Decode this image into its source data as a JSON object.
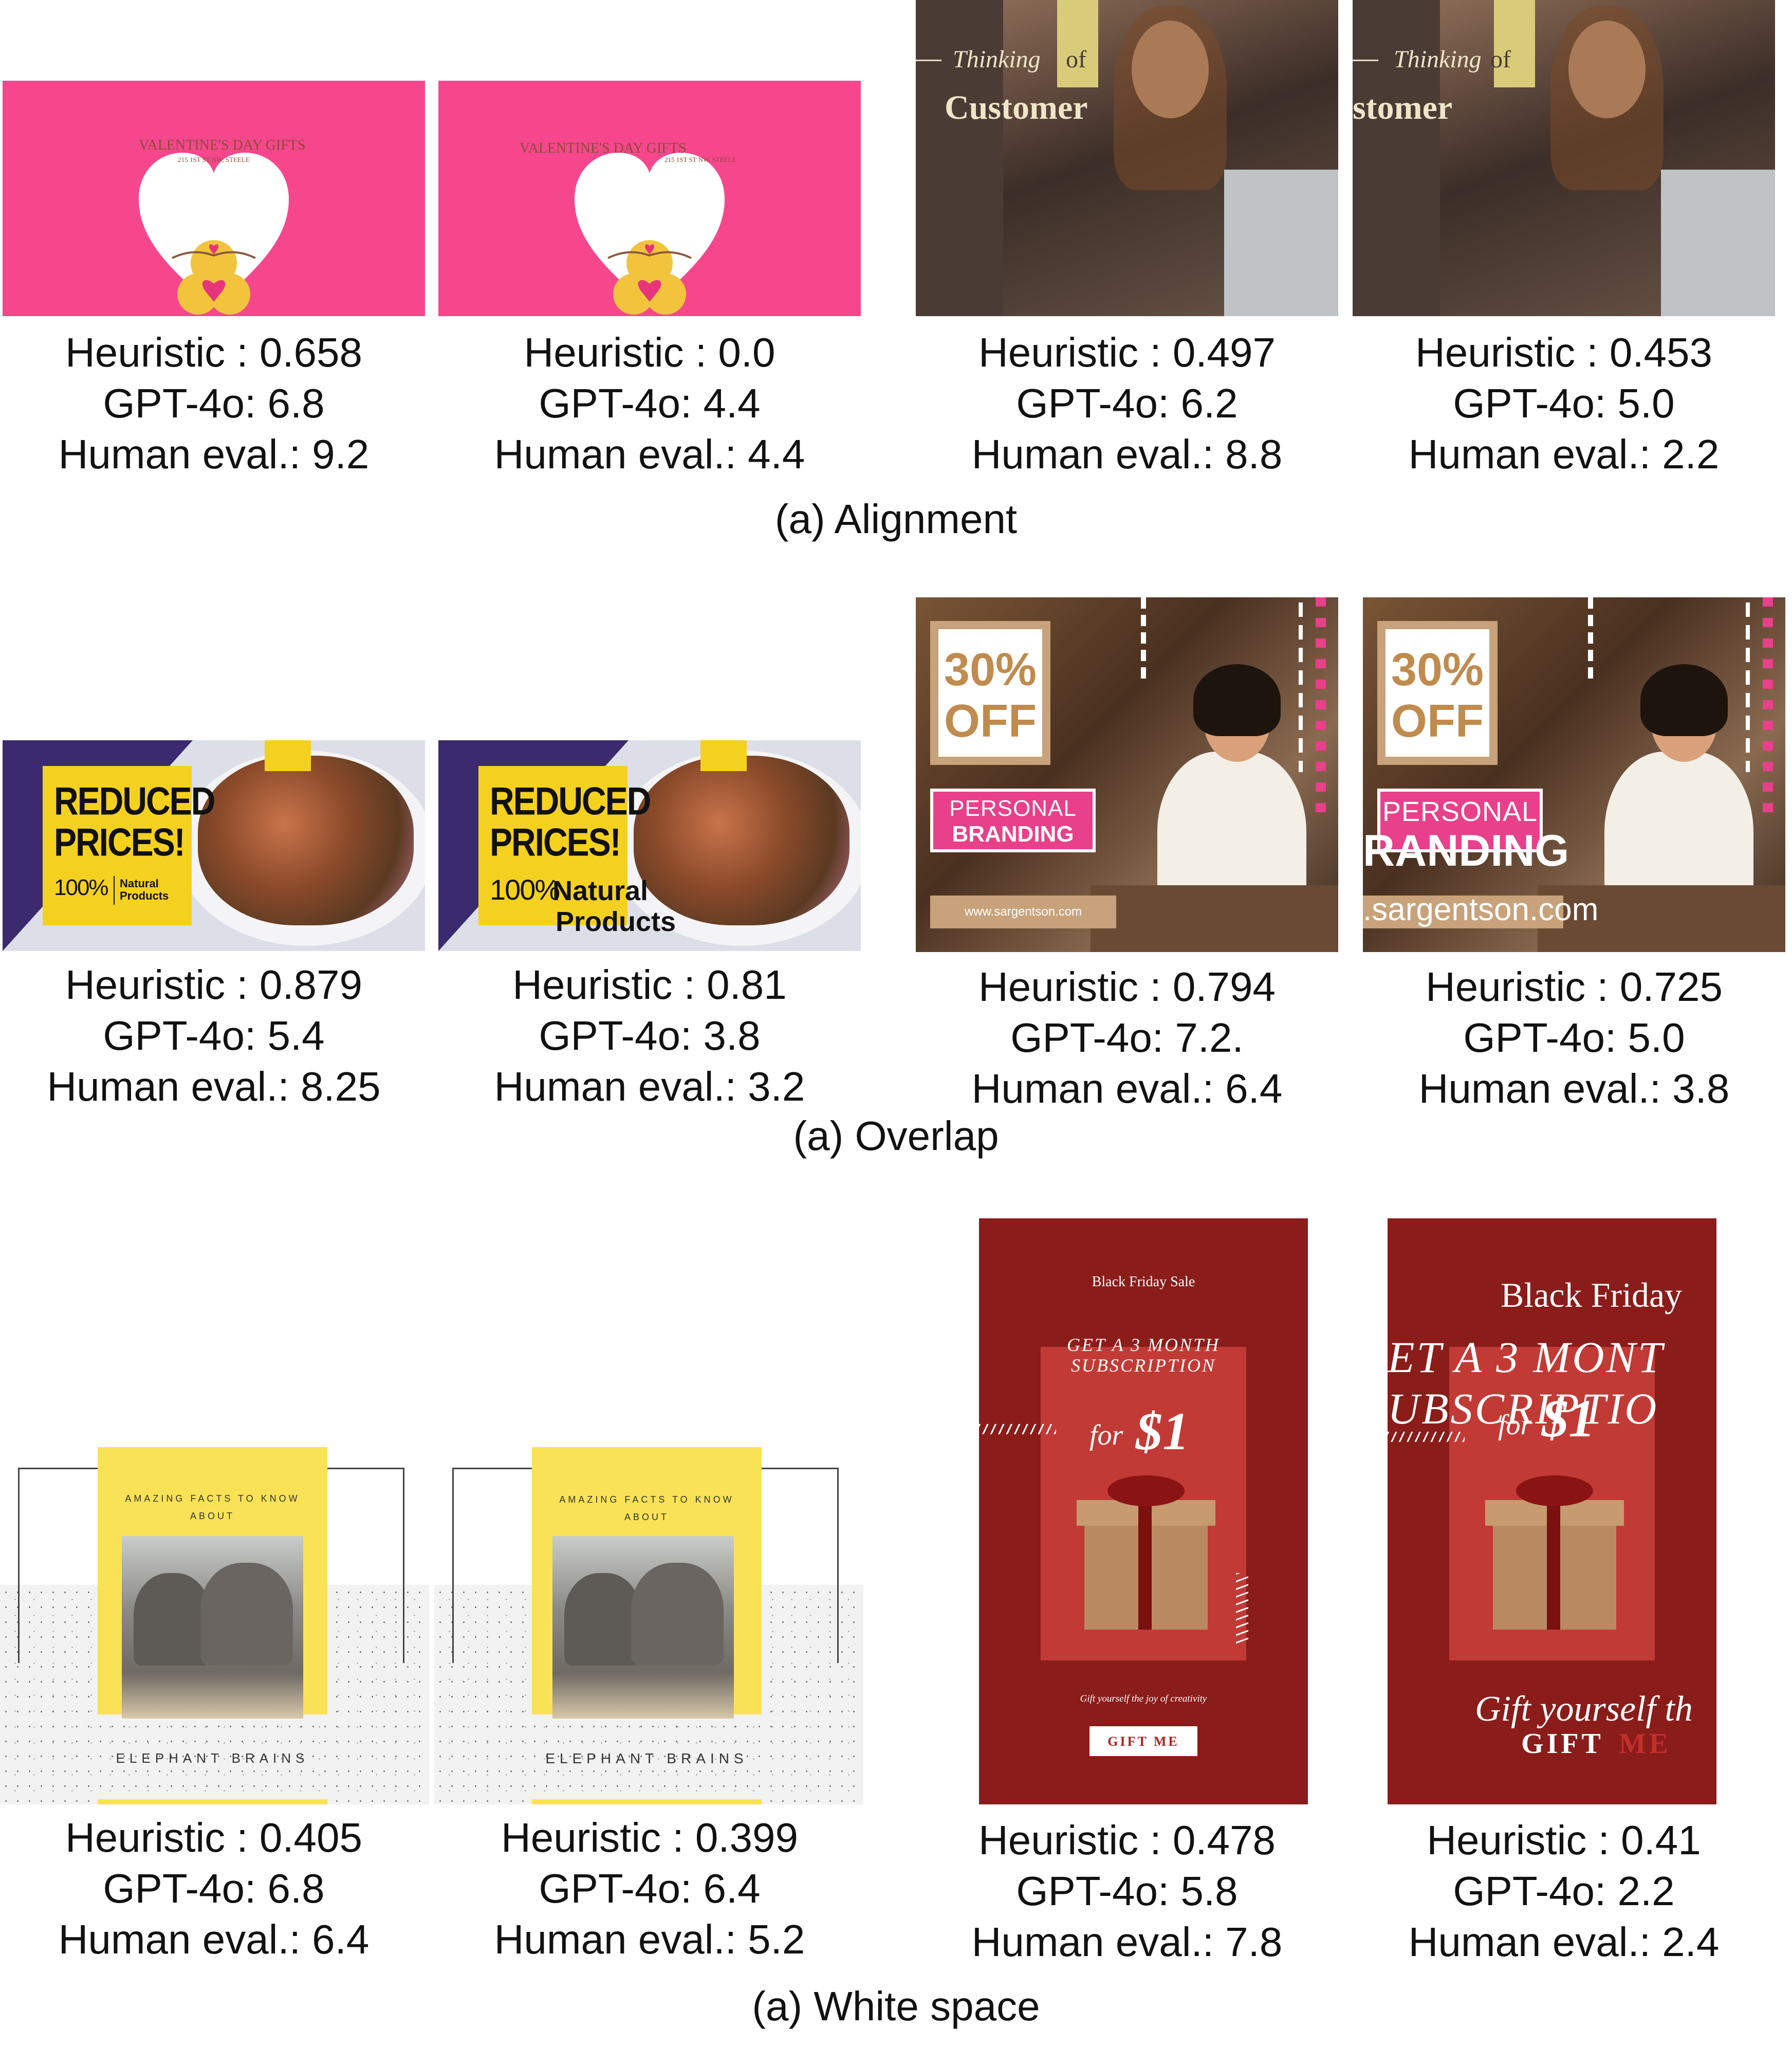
{
  "sections": [
    {
      "caption": "(a) Alignment",
      "items": [
        {
          "heuristic": "Heuristic : 0.658",
          "gpt": "GPT-4o: 6.8",
          "human": "Human eval.: 9.2"
        },
        {
          "heuristic": "Heuristic : 0.0",
          "gpt": "GPT-4o: 4.4",
          "human": "Human eval.: 4.4"
        },
        {
          "heuristic": "Heuristic : 0.497",
          "gpt": "GPT-4o: 6.2",
          "human": "Human eval.: 8.8"
        },
        {
          "heuristic": "Heuristic : 0.453",
          "gpt": "GPT-4o: 5.0",
          "human": "Human eval.: 2.2"
        }
      ]
    },
    {
      "caption": "(a) Overlap",
      "items": [
        {
          "heuristic": "Heuristic : 0.879",
          "gpt": "GPT-4o: 5.4",
          "human": "Human eval.: 8.25"
        },
        {
          "heuristic": "Heuristic : 0.81",
          "gpt": "GPT-4o: 3.8",
          "human": "Human eval.: 3.2"
        },
        {
          "heuristic": "Heuristic : 0.794",
          "gpt": "GPT-4o: 7.2.",
          "human": "Human eval.: 6.4"
        },
        {
          "heuristic": "Heuristic : 0.725",
          "gpt": "GPT-4o: 5.0",
          "human": "Human eval.: 3.8"
        }
      ]
    },
    {
      "caption": "(a) White space",
      "items": [
        {
          "heuristic": "Heuristic : 0.405",
          "gpt": "GPT-4o: 6.8",
          "human": "Human eval.: 6.4"
        },
        {
          "heuristic": "Heuristic : 0.399",
          "gpt": "GPT-4o: 6.4",
          "human": "Human eval.: 5.2"
        },
        {
          "heuristic": "Heuristic : 0.478",
          "gpt": "GPT-4o: 5.8",
          "human": "Human eval.: 7.8"
        },
        {
          "heuristic": "Heuristic : 0.41",
          "gpt": "GPT-4o: 2.2",
          "human": "Human eval.: 2.4"
        }
      ]
    }
  ],
  "thumbs": {
    "valentine_title": "VALENTINE'S DAY GIFTS",
    "valentine_address": "215 1ST ST NW, STEELE",
    "thinking": "Thinking",
    "of": "of",
    "customer": "Customer",
    "customer_cut": "stomer",
    "reduced": "REDUCED",
    "prices": "PRICES!",
    "hundred": "100%",
    "natural": "Natural",
    "products": "Products",
    "pct_off_1": "30%",
    "pct_off_2": "OFF",
    "personal": "PERSONAL",
    "branding": "BRANDING",
    "branding_cut": "RANDING",
    "url": "www.sargentson.com",
    "url_cut": ".sargentson.com",
    "amazing": "AMAZING FACTS TO KNOW",
    "about": "ABOUT",
    "elephant": "ELEPHANT BRAINS",
    "bf_sale": "Black Friday Sale",
    "bf_big": "Black Friday",
    "get3": "GET A 3 MONTH",
    "subscription": "SUBSCRIPTION",
    "get3_cut": "ET A 3 MONT",
    "subscription_cut": "UBSCRIPTIO",
    "for": "for",
    "dollar": "$1",
    "gift_line": "Gift yourself the joy of creativity",
    "gift_line_cut": "Gift yourself th",
    "gift_me": "GIFT ME",
    "gift_cut": "GIFT",
    "me_cut": "ME"
  }
}
